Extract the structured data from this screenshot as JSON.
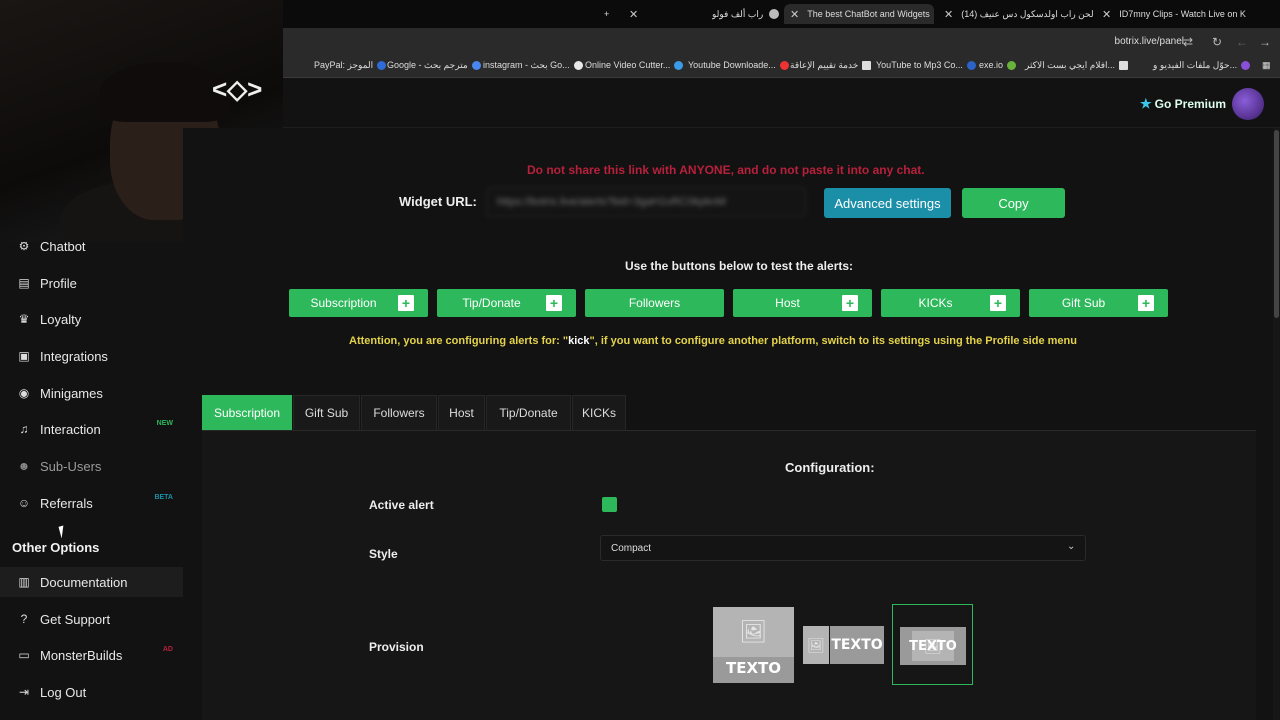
{
  "browser": {
    "tabs": [
      {
        "label": "",
        "close": "✕"
      },
      {
        "label": "راب ألف فولو",
        "close": "✕"
      },
      {
        "label": "The best ChatBot and Widgets",
        "close": "✕"
      },
      {
        "label": "(14) لحن راب اولدسكول دس عنيف",
        "close": "✕"
      },
      {
        "label": "ID7mny Clips - Watch Live on K",
        "close": "✕"
      }
    ],
    "new_tab": "+",
    "url": "botrix.live/panel",
    "bookmarks": [
      {
        "label": "PayPal: الموجز",
        "color": "#2f6bd6"
      },
      {
        "label": "Google - مترجم بحث",
        "color": "#4a86f0"
      },
      {
        "label": "instagram - بحث Go...",
        "color": "#e8e8e8"
      },
      {
        "label": "Online Video Cutter...",
        "color": "#3a9ce8"
      },
      {
        "label": "Youtube Downloade...",
        "color": "#e33"
      },
      {
        "label": "خدمة تقييم الإعاقة",
        "color": "#ddd"
      },
      {
        "label": "YouTube to Mp3 Co...",
        "color": "#2b63c9"
      },
      {
        "label": "exe.io",
        "color": "#67b33a"
      },
      {
        "label": "افلام ايجي بست الاكثر...",
        "color": "#ddd"
      },
      {
        "label": "حوّل ملفات الفيديو و...",
        "color": "#d33"
      }
    ]
  },
  "header": {
    "premium_label": "Go Premium"
  },
  "webcam": {
    "logo": "<◇>"
  },
  "sidebar": {
    "items": [
      {
        "label": "Chatbot",
        "icon": "🤖"
      },
      {
        "label": "Profile",
        "icon": "▤"
      },
      {
        "label": "Loyalty",
        "icon": "🏆"
      },
      {
        "label": "Integrations",
        "icon": "▣"
      },
      {
        "label": "Minigames",
        "icon": "🎮"
      },
      {
        "label": "Interaction",
        "icon": "♫",
        "badge": "NEW"
      },
      {
        "label": "Sub-Users",
        "icon": "👥"
      },
      {
        "label": "Referrals",
        "icon": "👤",
        "badge": "BETA"
      }
    ],
    "other_options_title": "Other Options",
    "other_items": [
      {
        "label": "Documentation",
        "icon": "📜"
      },
      {
        "label": "Get Support",
        "icon": "?"
      },
      {
        "label": "MonsterBuilds",
        "icon": "💻",
        "badge": "AD"
      },
      {
        "label": "Log Out",
        "icon": "⇥"
      }
    ]
  },
  "main": {
    "warning": "Do not share this link with ANYONE, and do not paste it into any chat.",
    "widget_url_label": "Widget URL:",
    "widget_url_value": "https://botrix.live/alerts?bid=3gaH1vRC0kpknM",
    "advanced_settings": "Advanced settings",
    "copy": "Copy",
    "test_label": "Use the buttons below to test the alerts:",
    "test_buttons": [
      "Subscription",
      "Tip/Donate",
      "Followers",
      "Host",
      "KICKs",
      "Gift Sub"
    ],
    "attention_pre": "Attention, you are configuring alerts for: \"",
    "attention_platform": "kick",
    "attention_post": "\", if you want to configure another platform, switch to its settings using the Profile side menu",
    "tabs": [
      "Subscription",
      "Gift Sub",
      "Followers",
      "Host",
      "Tip/Donate",
      "KICKs"
    ],
    "configuration_title": "Configuration:",
    "active_alert_label": "Active alert",
    "style_label": "Style",
    "style_value": "Compact",
    "provision_label": "Provision",
    "provision_text": "TEXTO"
  }
}
